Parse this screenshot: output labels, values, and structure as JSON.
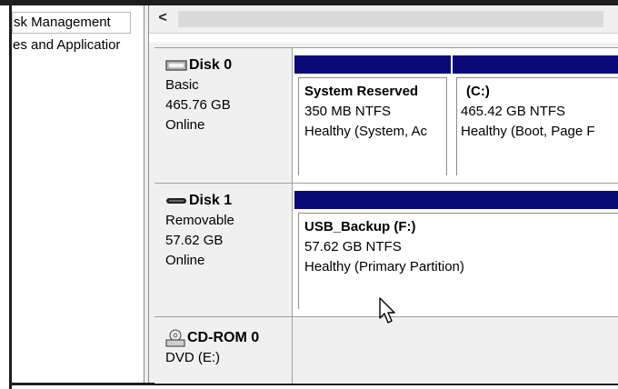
{
  "tree": {
    "items": [
      {
        "label": "sk Management",
        "selected": true
      },
      {
        "label": "es and Applicatior",
        "selected": false
      }
    ]
  },
  "scrollbar": {
    "left_arrow": "<"
  },
  "disks": [
    {
      "name": "Disk 0",
      "icon": "hard-disk-icon",
      "type": "Basic",
      "size": "465.76 GB",
      "status": "Online",
      "partitions": [
        {
          "name": "System Reserved",
          "size_fs": "350 MB NTFS",
          "status": "Healthy (System, Ac"
        },
        {
          "name": "(C:)",
          "size_fs": "465.42 GB NTFS",
          "status": "Healthy (Boot, Page F"
        }
      ]
    },
    {
      "name": "Disk 1",
      "icon": "removable-disk-icon",
      "type": "Removable",
      "size": "57.62 GB",
      "status": "Online",
      "partitions": [
        {
          "name": "USB_Backup  (F:)",
          "size_fs": "57.62 GB NTFS",
          "status": "Healthy (Primary Partition)"
        }
      ]
    },
    {
      "name": "CD-ROM 0",
      "icon": "cdrom-icon",
      "type": "DVD (E:)"
    }
  ],
  "colors": {
    "partition_bar": "#0a0a78",
    "label_bg": "#f0f0f0"
  }
}
